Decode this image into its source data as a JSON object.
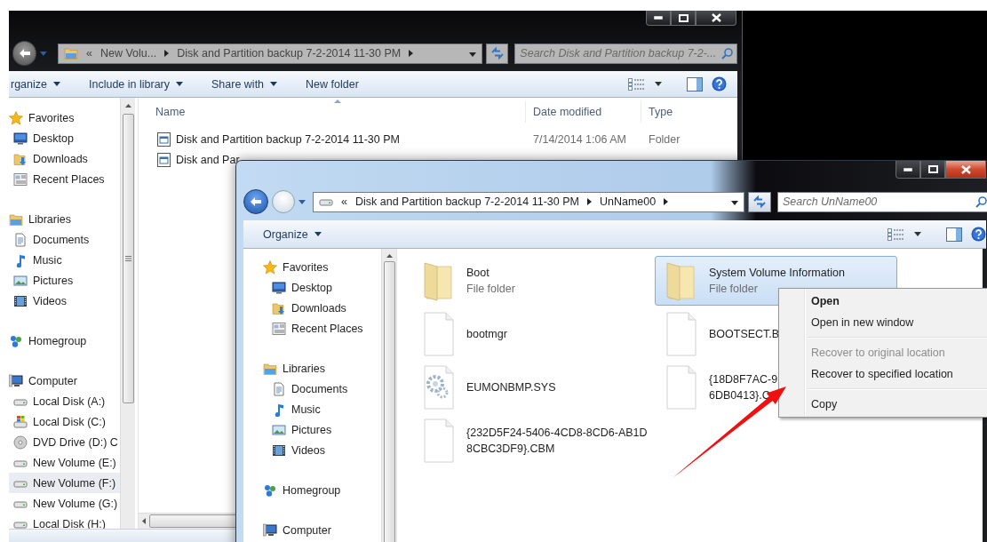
{
  "back_window": {
    "active": false,
    "address": {
      "overflow_mark": "«",
      "crumbs": [
        "New Volu...",
        "Disk and Partition backup 7-2-2014 11-30 PM"
      ]
    },
    "search": {
      "placeholder": "Search Disk and Partition backup 7-2-..."
    },
    "toolbar": [
      {
        "label": "rganize",
        "dropdown": true
      },
      {
        "label": "Include in library",
        "dropdown": true
      },
      {
        "label": "Share with",
        "dropdown": true
      },
      {
        "label": "New folder",
        "dropdown": false
      }
    ],
    "nav": [
      {
        "label": "Favorites",
        "kind": "star",
        "selected": false,
        "children": [
          {
            "label": "Desktop",
            "kind": "desktop",
            "selected": false
          },
          {
            "label": "Downloads",
            "kind": "downloads",
            "selected": false
          },
          {
            "label": "Recent Places",
            "kind": "recent",
            "selected": false
          }
        ]
      },
      {
        "label": "Libraries",
        "kind": "libraries",
        "selected": false,
        "children": [
          {
            "label": "Documents",
            "kind": "documents",
            "selected": false
          },
          {
            "label": "Music",
            "kind": "music",
            "selected": false
          },
          {
            "label": "Pictures",
            "kind": "pictures",
            "selected": false
          },
          {
            "label": "Videos",
            "kind": "videos",
            "selected": false
          }
        ]
      },
      {
        "label": "Homegroup",
        "kind": "homegroup",
        "selected": false
      },
      {
        "label": "Computer",
        "kind": "computer",
        "selected": false,
        "children": [
          {
            "label": "Local Disk (A:)",
            "kind": "drive",
            "selected": false
          },
          {
            "label": "Local Disk (C:)",
            "kind": "system_drive",
            "selected": false
          },
          {
            "label": "DVD Drive (D:) C",
            "kind": "dvd",
            "selected": false
          },
          {
            "label": "New Volume (E:)",
            "kind": "drive",
            "selected": false
          },
          {
            "label": "New Volume (F:)",
            "kind": "drive",
            "selected": true
          },
          {
            "label": "New Volume (G:)",
            "kind": "drive",
            "selected": false
          },
          {
            "label": "Local Disk (H:)",
            "kind": "drive",
            "selected": false
          }
        ]
      }
    ],
    "columns": [
      "Name",
      "Date modified",
      "Type"
    ],
    "rows": [
      {
        "name": "Disk and Partition backup 7-2-2014 11-30 PM",
        "date": "7/14/2014 1:06 AM",
        "type": "Folder"
      },
      {
        "name": "Disk and Par"
      }
    ]
  },
  "front_window": {
    "active": true,
    "address": {
      "overflow_mark": "«",
      "crumbs": [
        "Disk and Partition backup 7-2-2014 11-30 PM",
        "UnName00"
      ]
    },
    "search": {
      "placeholder": "Search UnName00"
    },
    "toolbar": [
      {
        "label": "Organize",
        "dropdown": true
      }
    ],
    "nav": [
      {
        "label": "Favorites",
        "kind": "star",
        "selected": false,
        "children": [
          {
            "label": "Desktop",
            "kind": "desktop",
            "selected": false
          },
          {
            "label": "Downloads",
            "kind": "downloads",
            "selected": false
          },
          {
            "label": "Recent Places",
            "kind": "recent",
            "selected": false
          }
        ]
      },
      {
        "label": "Libraries",
        "kind": "libraries",
        "selected": false,
        "children": [
          {
            "label": "Documents",
            "kind": "documents",
            "selected": false
          },
          {
            "label": "Music",
            "kind": "music",
            "selected": false
          },
          {
            "label": "Pictures",
            "kind": "pictures",
            "selected": false
          },
          {
            "label": "Videos",
            "kind": "videos",
            "selected": false
          }
        ]
      },
      {
        "label": "Homegroup",
        "kind": "homegroup",
        "selected": false
      },
      {
        "label": "Computer",
        "kind": "computer",
        "selected": false
      }
    ],
    "items": [
      {
        "kind": "folder",
        "lines": [
          "Boot"
        ],
        "type": "File folder",
        "selected": false
      },
      {
        "kind": "file",
        "lines": [
          "bootmgr"
        ],
        "selected": false
      },
      {
        "kind": "system",
        "lines": [
          "EUMONBMP.SYS"
        ],
        "selected": false
      },
      {
        "kind": "file",
        "lines": [
          "{232D5F24-5406-4CD8-8CD6-AB1D",
          "8CBC3DF9}.CBM"
        ],
        "selected": false
      },
      {
        "kind": "folder",
        "lines": [
          "System Volume Information"
        ],
        "type": "File folder",
        "selected": true
      },
      {
        "kind": "file",
        "lines": [
          "BOOTSECT.B"
        ],
        "selected": false
      },
      {
        "kind": "file",
        "lines": [
          "{18D8F7AC-9",
          "6DB0413}.C"
        ],
        "selected": false
      }
    ]
  },
  "context_menu": {
    "items": [
      {
        "kind": "item",
        "label": "Open",
        "default": true,
        "disabled": false
      },
      {
        "kind": "item",
        "label": "Open in new window",
        "default": false,
        "disabled": false
      },
      {
        "kind": "separator"
      },
      {
        "kind": "item",
        "label": "Recover to original location",
        "default": false,
        "disabled": true
      },
      {
        "kind": "item",
        "label": "Recover to specified location",
        "default": false,
        "disabled": false
      },
      {
        "kind": "separator"
      },
      {
        "kind": "item",
        "label": "Copy",
        "default": false,
        "disabled": false
      }
    ]
  }
}
